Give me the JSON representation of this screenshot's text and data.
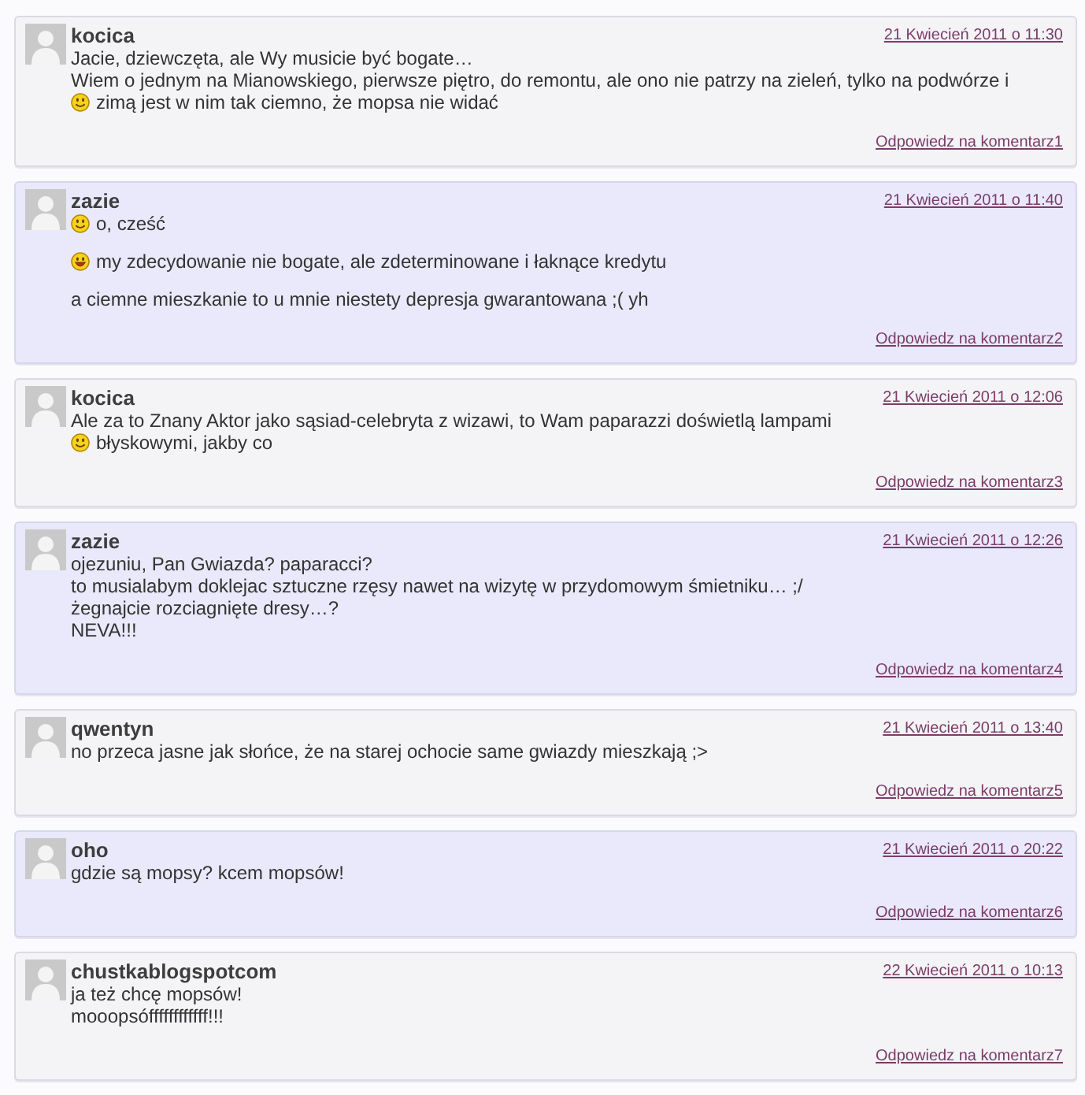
{
  "comments": [
    {
      "author": "kocica",
      "date": "21 Kwiecień 2011 o 11:30",
      "alt": false,
      "paragraphs": [
        [
          {
            "kind": "plain",
            "text": "Jacie, dziewczęta, ale Wy musicie być bogate…"
          },
          {
            "kind": "plain",
            "text": "Wiem o jednym na Mianowskiego, pierwsze piętro, do remontu, ale ono nie patrzy na zieleń, tylko na podwórze i"
          },
          {
            "kind": "smile",
            "text": "zimą jest w nim tak ciemno, że mopsa nie widać"
          }
        ]
      ],
      "reply": "Odpowiedz na komentarz1"
    },
    {
      "author": "zazie",
      "date": "21 Kwiecień 2011 o 11:40",
      "alt": true,
      "paragraphs": [
        [
          {
            "kind": "smile",
            "text": "o, cześć"
          }
        ],
        [
          {
            "kind": "laugh",
            "text": "my zdecydowanie nie bogate, ale zdeterminowane i łaknące kredytu"
          }
        ],
        [
          {
            "kind": "plain",
            "text": "a ciemne mieszkanie to u mnie niestety depresja gwarantowana ;( yh"
          }
        ]
      ],
      "reply": "Odpowiedz na komentarz2"
    },
    {
      "author": "kocica",
      "date": "21 Kwiecień 2011 o 12:06",
      "alt": false,
      "paragraphs": [
        [
          {
            "kind": "plain",
            "text": "Ale za to Znany Aktor jako sąsiad-celebryta z wizawi, to Wam paparazzi doświetlą lampami"
          },
          {
            "kind": "smile",
            "text": "błyskowymi, jakby co"
          }
        ]
      ],
      "reply": "Odpowiedz na komentarz3"
    },
    {
      "author": "zazie",
      "date": "21 Kwiecień 2011 o 12:26",
      "alt": true,
      "paragraphs": [
        [
          {
            "kind": "plain",
            "text": "ojezuniu, Pan Gwiazda? paparacci?"
          },
          {
            "kind": "plain",
            "text": "to musialabym doklejac sztuczne rzęsy nawet na wizytę w przydomowym śmietniku… ;/"
          },
          {
            "kind": "plain",
            "text": "żegnajcie rozciagnięte dresy…?"
          },
          {
            "kind": "plain",
            "text": "NEVA!!!"
          }
        ]
      ],
      "reply": "Odpowiedz na komentarz4"
    },
    {
      "author": "qwentyn",
      "date": "21 Kwiecień 2011 o 13:40",
      "alt": false,
      "paragraphs": [
        [
          {
            "kind": "plain",
            "text": "no przeca jasne jak słońce, że na starej ochocie same gwiazdy mieszkają ;>"
          }
        ]
      ],
      "reply": "Odpowiedz na komentarz5"
    },
    {
      "author": "oho",
      "date": "21 Kwiecień 2011 o 20:22",
      "alt": true,
      "paragraphs": [
        [
          {
            "kind": "plain",
            "text": "gdzie są mopsy? kcem mopsów!"
          }
        ]
      ],
      "reply": "Odpowiedz na komentarz6"
    },
    {
      "author": "chustkablogspotcom",
      "date": "22 Kwiecień 2011 o 10:13",
      "alt": false,
      "paragraphs": [
        [
          {
            "kind": "plain",
            "text": "ja też chcę mopsów!"
          },
          {
            "kind": "plain",
            "text": "mooopsóffffffffffff!!!"
          }
        ]
      ],
      "reply": "Odpowiedz na komentarz7"
    }
  ]
}
